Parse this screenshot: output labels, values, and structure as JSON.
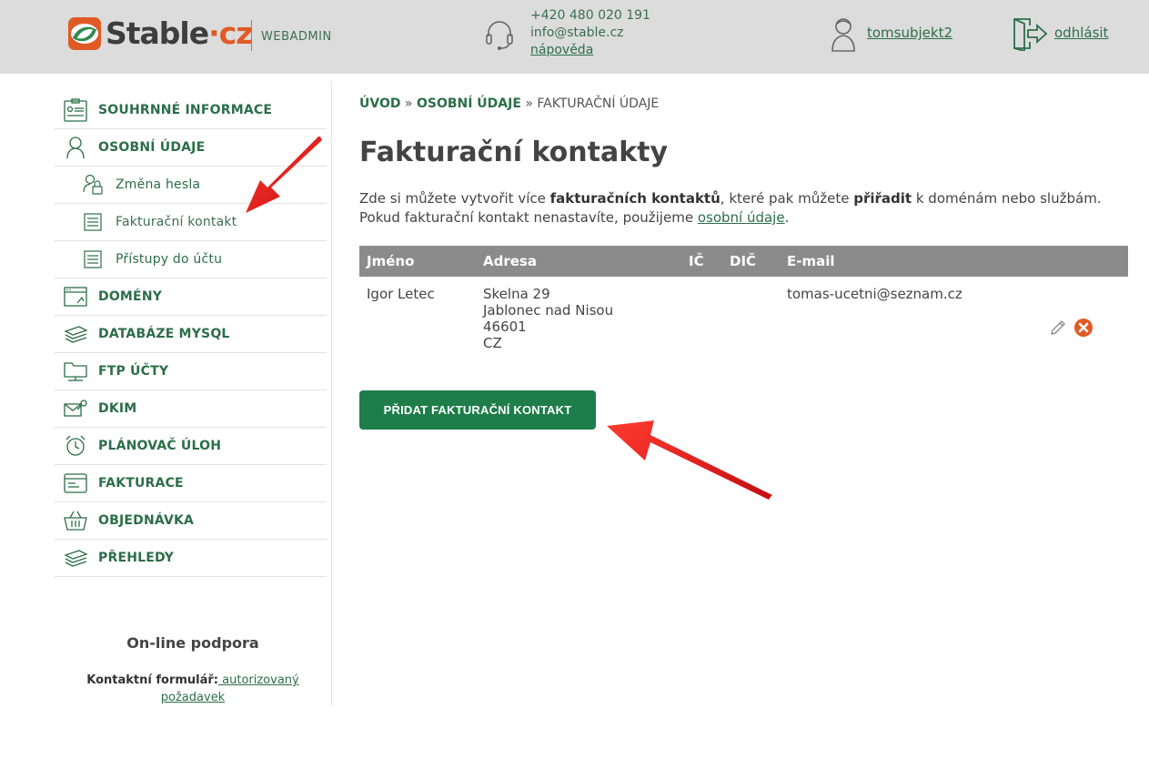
{
  "header": {
    "logo_text": "Stable",
    "logo_dot_text": "·cz",
    "webadmin": "WEBADMIN",
    "phone": "+420 480 020 191",
    "email": "info@stable.cz",
    "help": "nápověda",
    "user": "tomsubjekt2",
    "logout": "odhlásit"
  },
  "sidebar": {
    "items": [
      {
        "label": "SOUHRNNÉ INFORMACE",
        "icon": "summary-icon"
      },
      {
        "label": "OSOBNÍ ÚDAJE",
        "icon": "person-icon"
      },
      {
        "label": "Změna hesla",
        "icon": "password-icon"
      },
      {
        "label": "Fakturační kontakt",
        "icon": "document-icon"
      },
      {
        "label": "Přístupy do účtu",
        "icon": "document-icon"
      },
      {
        "label": "DOMÉNY",
        "icon": "browser-icon"
      },
      {
        "label": "DATABÁZE MYSQL",
        "icon": "database-icon"
      },
      {
        "label": "FTP ÚČTY",
        "icon": "ftp-folder-icon"
      },
      {
        "label": "DKIM",
        "icon": "mail-key-icon"
      },
      {
        "label": "PLÁNOVAČ ÚLOH",
        "icon": "alarm-clock-icon"
      },
      {
        "label": "FAKTURACE",
        "icon": "invoice-icon"
      },
      {
        "label": "OBJEDNÁVKA",
        "icon": "basket-icon"
      },
      {
        "label": "PŘEHLEDY",
        "icon": "stack-icon"
      }
    ],
    "support_title": "On-line podpora",
    "support_label": "Kontaktní formulář:",
    "support_link": " autorizovaný požadavek"
  },
  "breadcrumb": {
    "home": "ÚVOD",
    "sep1": " » ",
    "personal": "OSOBNÍ ÚDAJE",
    "sep2": " » ",
    "current": "FAKTURAČNÍ ÚDAJE"
  },
  "main": {
    "title": "Fakturační kontakty",
    "intro_1": "Zde si můžete vytvořit více ",
    "intro_b1": "fakturačních kontaktů",
    "intro_2": ", které pak můžete ",
    "intro_b2": "přiřadit",
    "intro_3": " k doménám nebo službám. Pokud fakturační kontakt nenastavíte, použijeme ",
    "intro_link": "osobní údaje",
    "intro_4": ".",
    "add_button": "PŘIDAT FAKTURAČNÍ KONTAKT"
  },
  "table": {
    "headers": {
      "name": "Jméno",
      "address": "Adresa",
      "ic": "IČ",
      "dic": "DIČ",
      "email": "E-mail"
    },
    "rows": [
      {
        "name": "Igor Letec",
        "street": "Skelna 29",
        "city": "Jablonec nad Nisou",
        "zip": "46601",
        "country": "CZ",
        "ic": "",
        "dic": "",
        "email": "tomas-ucetni@seznam.cz"
      }
    ]
  },
  "colors": {
    "brand_green": "#1e7d4a",
    "link_green": "#2c6e49",
    "header_bg": "#dcdcdc",
    "table_header_bg": "#8b8b8b",
    "delete_orange": "#e05a25",
    "annotation_red": "#e4141b"
  }
}
